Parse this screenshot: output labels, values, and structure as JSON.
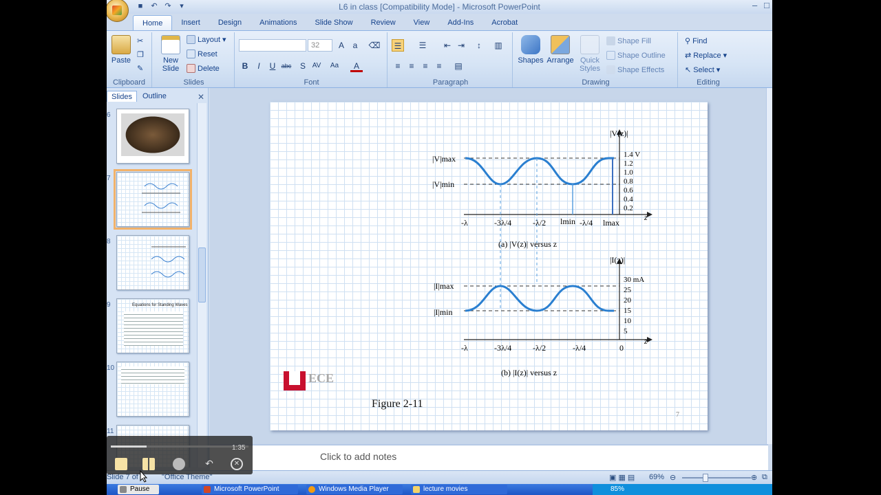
{
  "window": {
    "title": "L6 in class [Compatibility Mode] - Microsoft PowerPoint"
  },
  "tabs": [
    "Home",
    "Insert",
    "Design",
    "Animations",
    "Slide Show",
    "Review",
    "View",
    "Add-Ins",
    "Acrobat"
  ],
  "ribbon": {
    "clipboard": {
      "label": "Clipboard",
      "paste": "Paste"
    },
    "slides": {
      "label": "Slides",
      "new_slide": "New Slide",
      "layout": "Layout",
      "reset": "Reset",
      "delete": "Delete"
    },
    "font": {
      "label": "Font",
      "size": "32"
    },
    "paragraph": {
      "label": "Paragraph"
    },
    "drawing": {
      "label": "Drawing",
      "shapes": "Shapes",
      "arrange": "Arrange",
      "quick_styles": "Quick Styles",
      "shape_fill": "Shape Fill",
      "shape_outline": "Shape Outline",
      "shape_effects": "Shape Effects"
    },
    "editing": {
      "label": "Editing",
      "find": "Find",
      "replace": "Replace",
      "select": "Select"
    }
  },
  "pane": {
    "tab_slides": "Slides",
    "tab_outline": "Outline",
    "numbers": [
      "6",
      "7",
      "8",
      "9",
      "10",
      "11"
    ]
  },
  "thumb_texts": {
    "t9_title": "Equations for Standing Waves"
  },
  "slide": {
    "figure_caption": "Figure 2-11",
    "page_number": "7",
    "logo_text": "ECE",
    "chart_a": {
      "y_title": "|V(z)|",
      "y_ticks": [
        "1.4 V",
        "1.2",
        "1.0",
        "0.8",
        "0.6",
        "0.4",
        "0.2"
      ],
      "vmax_label": "|V|max",
      "vmin_label": "|V|min",
      "x_labels": [
        "-λ",
        "-3λ/4",
        "-λ/2",
        "lmin",
        "-λ/4",
        "lmax"
      ],
      "axis_z": "z",
      "caption": "(a)  |V(z)|  versus  z"
    },
    "chart_b": {
      "y_title": "|I(z)|",
      "y_ticks": [
        "30 mA",
        "25",
        "20",
        "15",
        "10",
        "5"
      ],
      "imax_label": "|I|max",
      "imin_label": "|I|min",
      "x_labels": [
        "-λ",
        "-3λ/4",
        "-λ/2",
        "-λ/4",
        "0"
      ],
      "axis_z": "z",
      "caption": "(b)  |I(z)|  versus  z"
    }
  },
  "notes": {
    "placeholder": "Click to add notes"
  },
  "status": {
    "slide": "Slide 7 of",
    "theme": "\"Office Theme\"",
    "zoom": "69%"
  },
  "player": {
    "time": "1:35",
    "tooltip": "Pause"
  },
  "taskbar": {
    "items": [
      "Pause",
      "Microsoft PowerPoint",
      "Windows Media Player",
      "lecture movies"
    ],
    "battery": "85%"
  },
  "colors": {
    "accent": "#15428b",
    "curve": "#2a7fd0",
    "thumb_selected": "#f2b26a"
  }
}
